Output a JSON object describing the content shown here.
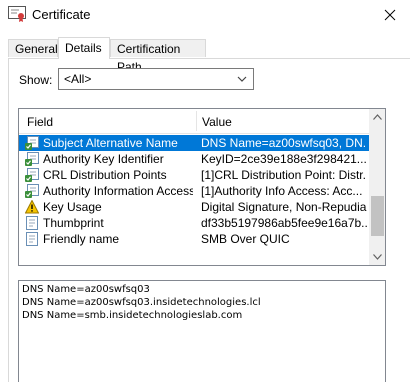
{
  "window": {
    "title": "Certificate",
    "icon": "certificate-icon",
    "close_icon": "close-icon"
  },
  "tabs": [
    {
      "label": "General",
      "active": false
    },
    {
      "label": "Details",
      "active": true
    },
    {
      "label": "Certification Path",
      "active": false
    }
  ],
  "show": {
    "label": "Show:",
    "value": "<All>"
  },
  "list": {
    "headers": {
      "field": "Field",
      "value": "Value"
    },
    "rows": [
      {
        "field": "Subject Alternative Name",
        "value": "DNS Name=az00swfsq03, DN...",
        "icon": "extension-icon",
        "selected": true
      },
      {
        "field": "Authority Key Identifier",
        "value": "KeyID=2ce39e188e3f298421...",
        "icon": "extension-icon",
        "selected": false
      },
      {
        "field": "CRL Distribution Points",
        "value": "[1]CRL Distribution Point: Distr...",
        "icon": "extension-icon",
        "selected": false
      },
      {
        "field": "Authority Information Access",
        "value": "[1]Authority Info Access: Acc...",
        "icon": "extension-icon",
        "selected": false
      },
      {
        "field": "Key Usage",
        "value": "Digital Signature, Non-Repudia...",
        "icon": "warning-extension-icon",
        "selected": false
      },
      {
        "field": "Thumbprint",
        "value": "df33b5197986ab5fee9e16a7b...",
        "icon": "property-icon",
        "selected": false
      },
      {
        "field": "Friendly name",
        "value": "SMB Over QUIC",
        "icon": "property-icon",
        "selected": false
      }
    ],
    "scroll_position": 0.85
  },
  "detail_lines": [
    "DNS Name=az00swfsq03",
    "DNS Name=az00swfsq03.insidetechnologies.lcl",
    "DNS Name=smb.insidetechnologieslab.com"
  ],
  "colors": {
    "selection": "#0078d7",
    "warning": "#f5c400"
  }
}
